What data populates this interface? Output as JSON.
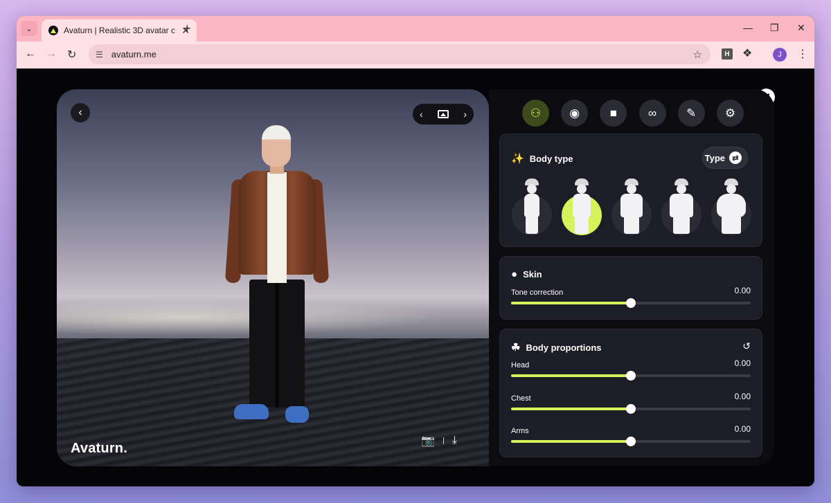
{
  "browser": {
    "tab_title": "Avaturn | Realistic 3D avatar cre",
    "url": "avaturn.me",
    "profile_initial": "J",
    "extension_label": "H"
  },
  "viewer": {
    "brand": "Avaturn."
  },
  "categories": [
    {
      "icon": "body-shape-icon",
      "active": true
    },
    {
      "icon": "hair-icon",
      "active": false
    },
    {
      "icon": "shirt-icon",
      "active": false
    },
    {
      "icon": "glasses-icon",
      "active": false
    },
    {
      "icon": "makeup-icon",
      "active": false
    },
    {
      "icon": "animation-icon",
      "active": false
    }
  ],
  "body_type": {
    "title": "Body type",
    "type_button": "Type",
    "selected_index": 1,
    "options_count": 5
  },
  "skin": {
    "title": "Skin",
    "tone_label": "Tone correction",
    "tone_value": "0.00",
    "tone_fraction": 0.5
  },
  "proportions": {
    "title": "Body proportions",
    "sliders": [
      {
        "label": "Head",
        "value": "0.00",
        "fraction": 0.5
      },
      {
        "label": "Chest",
        "value": "0.00",
        "fraction": 0.5
      },
      {
        "label": "Arms",
        "value": "0.00",
        "fraction": 0.5
      }
    ]
  },
  "colors": {
    "accent": "#d6f25b",
    "card": "#1c1d27",
    "tab_strip": "#fbb6c3"
  }
}
